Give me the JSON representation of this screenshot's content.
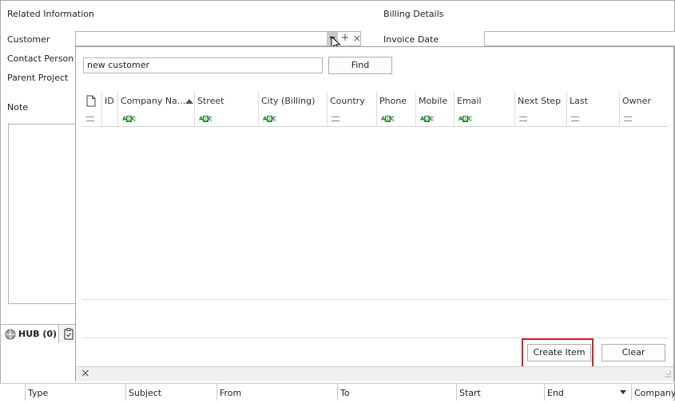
{
  "form": {
    "related_info": "Related Information",
    "billing_details": "Billing Details",
    "customer_label": "Customer",
    "contact_label": "Contact Person",
    "parent_label": "Parent Project",
    "note_label": "Note",
    "invoice_date_label": "Invoice Date",
    "plus_glyph": "+",
    "x_glyph": "×"
  },
  "hub": {
    "tab_label": "HUB (0)"
  },
  "popup": {
    "search_value": "new customer",
    "find_label": "Find",
    "columns": [
      "ID",
      "Company Na...",
      "Street (Billing)",
      "City (Billing)",
      "Country (...",
      "Phone",
      "Mobile",
      "Email",
      "Next Step",
      "Last Activity",
      "Owner"
    ],
    "create_label": "Create Item",
    "clear_label": "Clear",
    "close_glyph": "×"
  },
  "bottom_columns": [
    "Type",
    "Subject",
    "From",
    "To",
    "Start",
    "End",
    "Company"
  ],
  "colors": {
    "highlight": "#d61f26",
    "abc_icon": "#2a8a3a"
  }
}
